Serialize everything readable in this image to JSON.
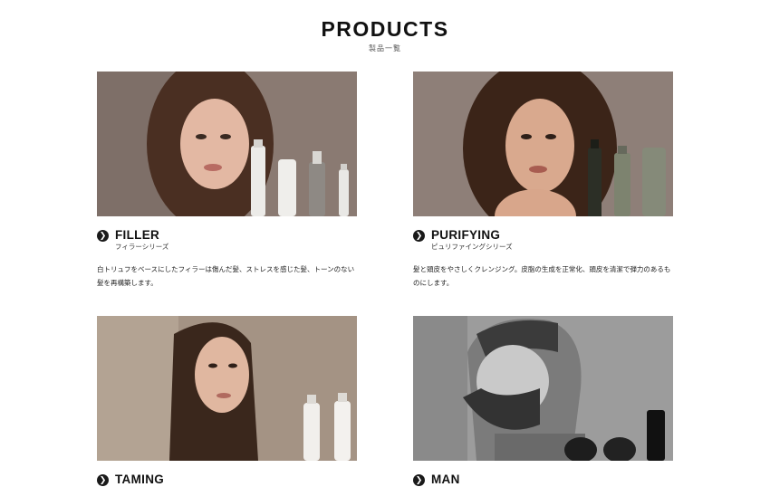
{
  "header": {
    "title": "PRODUCTS",
    "subtitle": "製品一覧"
  },
  "products": [
    {
      "name": "FILLER",
      "sub": "フィラーシリーズ",
      "desc": "白トリュフをベースにしたフィラーは傷んだ髪、ストレスを感じた髪、トーンのない髪を再構築します。",
      "image": "woman-wavy-hair-with-filler-bottles"
    },
    {
      "name": "PURIFYING",
      "sub": "ピュリファイングシリーズ",
      "desc": "髪と頭皮をやさしくクレンジング。皮脂の生成を正常化、頭皮を清潔で弾力のあるものにします。",
      "image": "woman-curly-hair-with-purifying-bottles"
    },
    {
      "name": "TAMING",
      "sub": "",
      "desc": "",
      "image": "woman-straight-hair-with-taming-bottles"
    },
    {
      "name": "MAN",
      "sub": "",
      "desc": "",
      "image": "bearded-man-with-grooming-products"
    }
  ],
  "icons": {
    "arrow": "chevron-right-icon"
  },
  "colors": {
    "text": "#111111",
    "arrow_bg": "#1a1a1a",
    "photo_warm": "#8c7b72",
    "photo_gray": "#9a9a9a"
  }
}
